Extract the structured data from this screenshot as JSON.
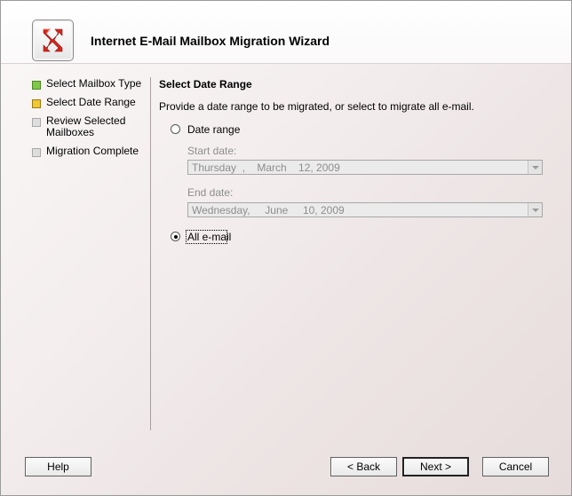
{
  "wizard": {
    "title": "Internet E-Mail Mailbox Migration Wizard",
    "icon": "exchange-logo-icon"
  },
  "steps": [
    {
      "label": "Select Mailbox Type",
      "status": "done"
    },
    {
      "label": "Select Date Range",
      "status": "current"
    },
    {
      "label_line1": "Review Selected",
      "label_line2": "Mailboxes",
      "status": "pending"
    },
    {
      "label": "Migration Complete",
      "status": "pending"
    }
  ],
  "main": {
    "section_title": "Select Date Range",
    "description": "Provide a date range to be migrated, or select to migrate all e-mail.",
    "options": {
      "date_range": {
        "label": "Date range",
        "selected": false
      },
      "all_email": {
        "label": "All e-mail",
        "selected": true
      }
    },
    "start_date": {
      "label": "Start date:",
      "value": "Thursday  ,    March    12, 2009"
    },
    "end_date": {
      "label": "End date:",
      "value": "Wednesday,     June     10, 2009"
    }
  },
  "buttons": {
    "help": "Help",
    "back": "< Back",
    "next": "Next >",
    "cancel": "Cancel"
  },
  "colors": {
    "step_done": "#7ec84a",
    "step_current": "#f2c735",
    "step_pending": "#dedede"
  }
}
